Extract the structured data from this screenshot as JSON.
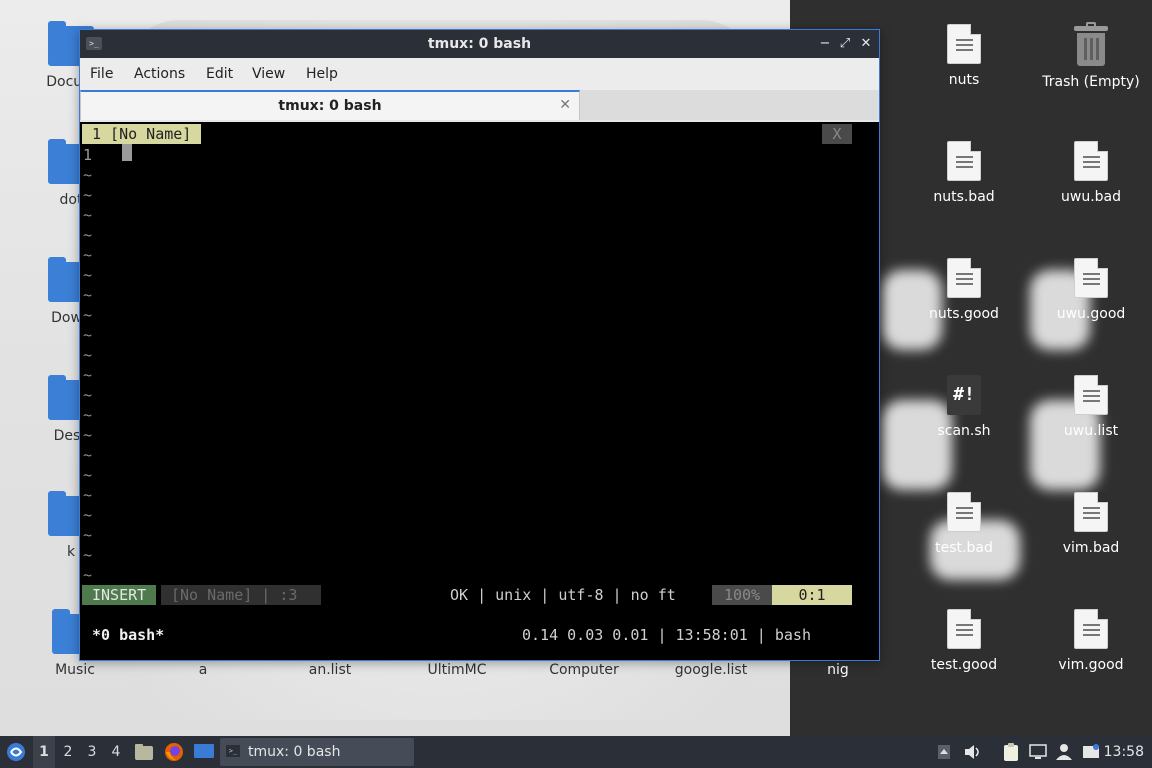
{
  "desktop": {
    "left_icons": [
      "Docum",
      "dot",
      "Down",
      "Desk",
      "k",
      "Music"
    ],
    "bottom_labels": [
      "a",
      "an.list",
      "UltimMC",
      "Computer",
      "google.list",
      "nig"
    ],
    "right_icons": [
      {
        "label": "nuts",
        "icon": "text-file-icon"
      },
      {
        "label": "Trash (Empty)",
        "icon": "trash-icon"
      },
      {
        "label": "nuts.bad",
        "icon": "text-file-icon"
      },
      {
        "label": "uwu.bad",
        "icon": "text-file-icon"
      },
      {
        "label": "nuts.good",
        "icon": "text-file-icon"
      },
      {
        "label": "uwu.good",
        "icon": "text-file-icon"
      },
      {
        "label": "scan.sh",
        "icon": "script-icon"
      },
      {
        "label": "uwu.list",
        "icon": "text-file-icon"
      },
      {
        "label": "test.bad",
        "icon": "text-file-icon"
      },
      {
        "label": "vim.bad",
        "icon": "text-file-icon"
      },
      {
        "label": "test.good",
        "icon": "text-file-icon"
      },
      {
        "label": "vim.good",
        "icon": "text-file-icon"
      }
    ]
  },
  "window": {
    "title": "tmux: 0 bash",
    "app_icon_glyph": ">_",
    "minimize": "−",
    "maximize": "⤢",
    "close": "✕",
    "menu": [
      "File",
      "Actions",
      "Edit",
      "View",
      "Help"
    ],
    "tab_label": "tmux: 0 bash",
    "tab_close": "✕"
  },
  "vim": {
    "tab_label": "1 [No Name]",
    "tab_close": "X",
    "line_number": "1",
    "tilde": "~",
    "mode": "INSERT",
    "file_info": "[No Name] | :3",
    "status_info": "OK | unix | utf-8 | no ft",
    "percent": "100%",
    "position": "0:1"
  },
  "tmux": {
    "window_list": "*0 bash*",
    "status_right": "0.14 0.03 0.01 | 13:58:01 | bash"
  },
  "taskbar": {
    "workspaces": [
      "1",
      "2",
      "3",
      "4"
    ],
    "active_workspace": "1",
    "task_label": "tmux: 0 bash",
    "clock": "13:58"
  },
  "colors": {
    "accent": "#3a7bd5",
    "titlebar": "#2b2f38",
    "vim_insert": "#4e7a4e",
    "vim_highlight": "#d7d7a0"
  }
}
